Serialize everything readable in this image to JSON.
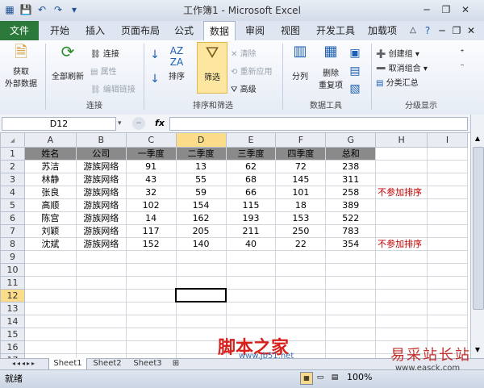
{
  "window": {
    "title": "工作簿1 - Microsoft Excel"
  },
  "ribbon_tabs": [
    "文件",
    "开始",
    "插入",
    "页面布局",
    "公式",
    "数据",
    "审阅",
    "视图",
    "开发工具",
    "加载项"
  ],
  "ribbon": {
    "get_external": "获取\n外部数据",
    "get_external_l1": "获取",
    "get_external_l2": "外部数据",
    "refresh_all": "全部刷新",
    "connections": "连接",
    "properties": "属性",
    "edit_links": "编辑链接",
    "group_connections": "连接",
    "sort": "排序",
    "filter": "筛选",
    "clear": "清除",
    "reapply": "重新应用",
    "advanced": "高级",
    "group_sort_filter": "排序和筛选",
    "text_to_columns": "分列",
    "remove_duplicates_l1": "删除",
    "remove_duplicates_l2": "重复项",
    "group_data_tools": "数据工具",
    "group_outline": "创建组",
    "ungroup": "取消组合",
    "subtotal": "分类汇总",
    "group_outline_label": "分级显示"
  },
  "formula_bar": {
    "name_box": "D12",
    "fx": "fx",
    "formula": ""
  },
  "columns": [
    "A",
    "B",
    "C",
    "D",
    "E",
    "F",
    "G",
    "H",
    "I"
  ],
  "rows": [
    "1",
    "2",
    "3",
    "4",
    "5",
    "6",
    "7",
    "8",
    "9",
    "10",
    "11",
    "12",
    "13",
    "14",
    "15",
    "16",
    "17"
  ],
  "selected": {
    "cell": "D12",
    "col": "D",
    "row": "12"
  },
  "table": {
    "header": [
      "姓名",
      "公司",
      "一季度",
      "二季度",
      "三季度",
      "四季度",
      "总和"
    ],
    "body": [
      [
        "苏洁",
        "游族网络",
        "91",
        "13",
        "62",
        "72",
        "238",
        ""
      ],
      [
        "林静",
        "游族网络",
        "43",
        "55",
        "68",
        "145",
        "311",
        ""
      ],
      [
        "张良",
        "游族网络",
        "32",
        "59",
        "66",
        "101",
        "258",
        "不参加排序"
      ],
      [
        "高顺",
        "游族网络",
        "102",
        "154",
        "115",
        "18",
        "389",
        ""
      ],
      [
        "陈宫",
        "游族网络",
        "14",
        "162",
        "193",
        "153",
        "522",
        ""
      ],
      [
        "刘颖",
        "游族网络",
        "117",
        "205",
        "211",
        "250",
        "783",
        ""
      ],
      [
        "沈斌",
        "游族网络",
        "152",
        "140",
        "40",
        "22",
        "354",
        "不参加排序"
      ]
    ]
  },
  "sheet_tabs": [
    "Sheet1",
    "Sheet2",
    "Sheet3"
  ],
  "status": {
    "ready": "就绪",
    "zoom": "100%"
  },
  "watermarks": {
    "site1": "脚本之家",
    "site1_sub": "www.jb51.net",
    "site2": "易采站长站",
    "site2_url": "www.easck.com"
  },
  "colors": {
    "file_tab": "#2b7a3c",
    "header_row": "#8a8a8a",
    "selected_header": "#fbdc8a",
    "note": "#c00000"
  }
}
